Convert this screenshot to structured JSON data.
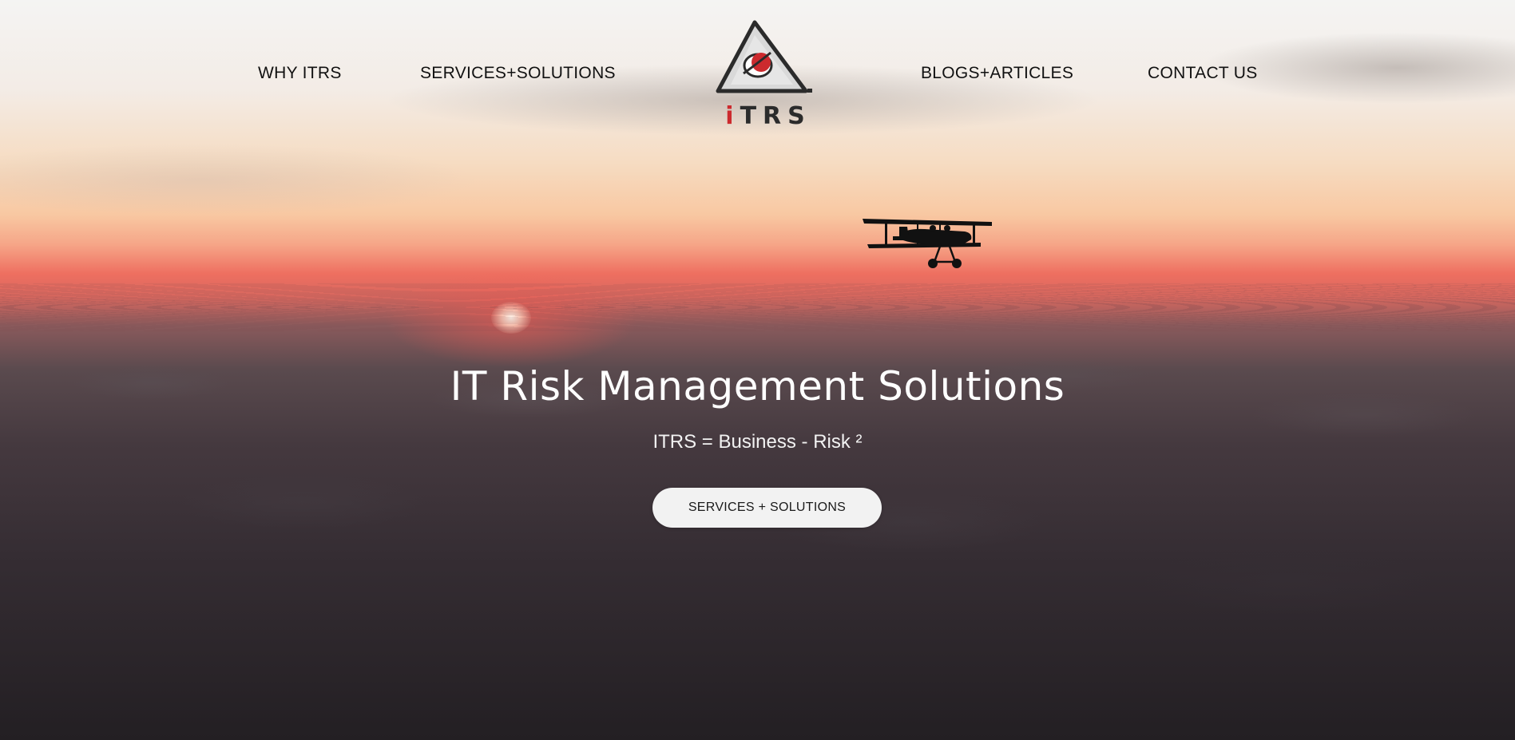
{
  "nav": {
    "items": [
      {
        "label": "WHY ITRS"
      },
      {
        "label": "SERVICES+SOLUTIONS"
      },
      {
        "label": "BLOGS+ARTICLES"
      },
      {
        "label": "CONTACT US"
      }
    ],
    "logo": {
      "text_i": "i",
      "text_rest": "TRS",
      "icon": "triangle-eye-logo-icon"
    }
  },
  "hero": {
    "title": "IT Risk Management Solutions",
    "subtitle": "ITRS = Business - Risk ²",
    "cta_label": "SERVICES + SOLUTIONS",
    "background_image": "sunset-over-clouds-with-biplane"
  },
  "colors": {
    "brand_red": "#cc2a2e",
    "logo_dark": "#2b2b2b",
    "nav_text": "#111111",
    "hero_text": "#ffffff",
    "button_bg": "#f2f2f2"
  }
}
